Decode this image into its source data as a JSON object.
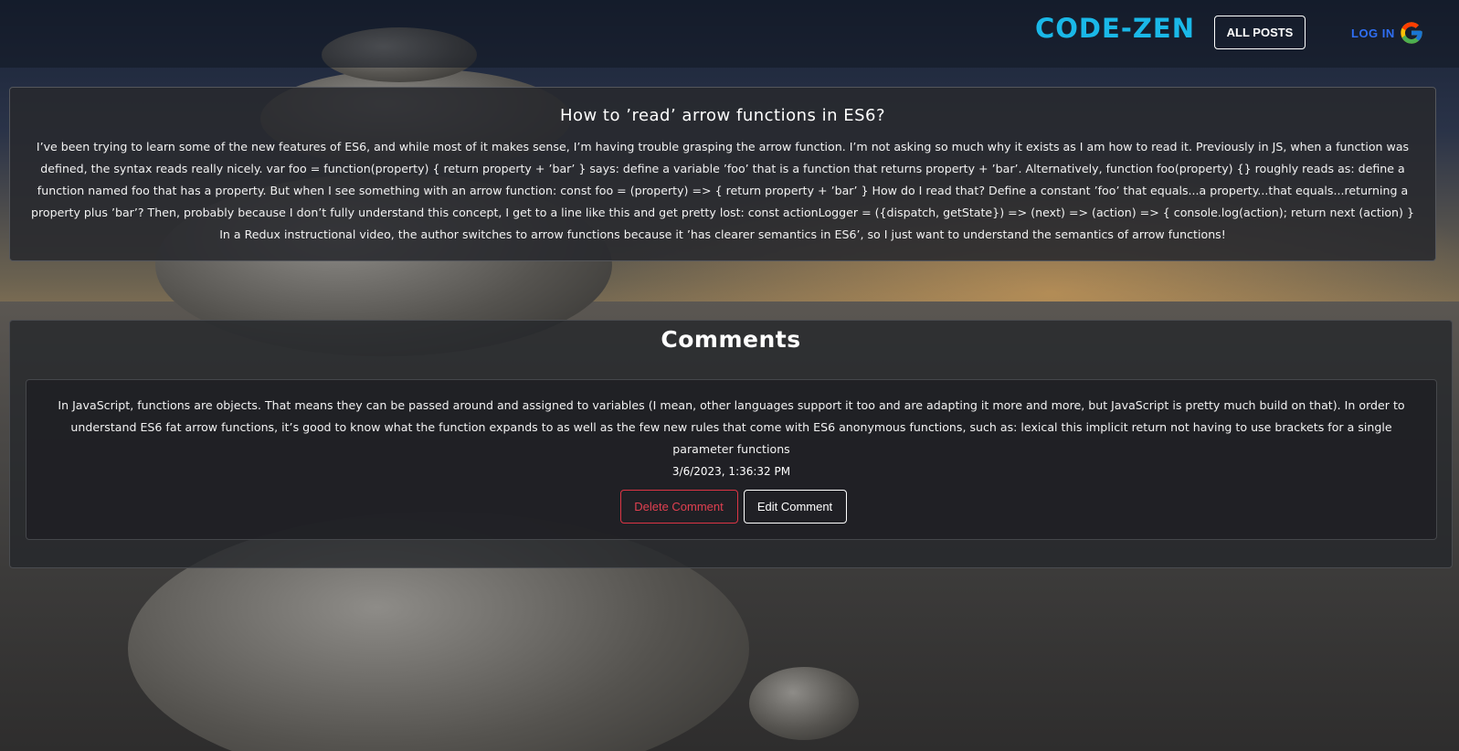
{
  "navbar": {
    "brand": "CODE-ZEN",
    "all_posts_label": "ALL POSTS",
    "login_label": "LOG IN",
    "login_icon": "google-icon"
  },
  "post": {
    "title": "How to ’read’ arrow functions in ES6?",
    "body": "I’ve been trying to learn some of the new features of ES6, and while most of it makes sense, I’m having trouble grasping the arrow function. I’m not asking so much why it exists as I am how to read it. Previously in JS, when a function was defined, the syntax reads really nicely. var foo = function(property) { return property + ’bar’ } says: define a variable ’foo’ that is a function that returns property + ’bar’. Alternatively, function foo(property) {} roughly reads as: define a function named foo that has a property. But when I see something with an arrow function: const foo = (property) => { return property + ’bar’ } How do I read that? Define a constant ’foo’ that equals...a property...that equals...returning a property plus ’bar’? Then, probably because I don’t fully understand this concept, I get to a line like this and get pretty lost: const actionLogger = ({dispatch, getState}) => (next) => (action) => { console.log(action); return next (action) } In a Redux instructional video, the author switches to arrow functions because it ’has clearer semantics in ES6’, so I just want to understand the semantics of arrow functions!"
  },
  "comments": {
    "heading": "Comments",
    "items": [
      {
        "body": "In JavaScript, functions are objects. That means they can be passed around and assigned to variables (I mean, other languages support it too and are adapting it more and more, but JavaScript is pretty much build on that). In order to understand ES6 fat arrow functions, it’s good to know what the function expands to as well as the few new rules that come with ES6 anonymous functions, such as: lexical this implicit return not having to use brackets for a single parameter functions",
        "date": "3/6/2023, 1:36:32 PM",
        "delete_label": "Delete Comment",
        "edit_label": "Edit Comment"
      }
    ]
  },
  "colors": {
    "brand": "#1ab8e8",
    "login": "#2f6ff5",
    "danger": "#dc3545"
  }
}
